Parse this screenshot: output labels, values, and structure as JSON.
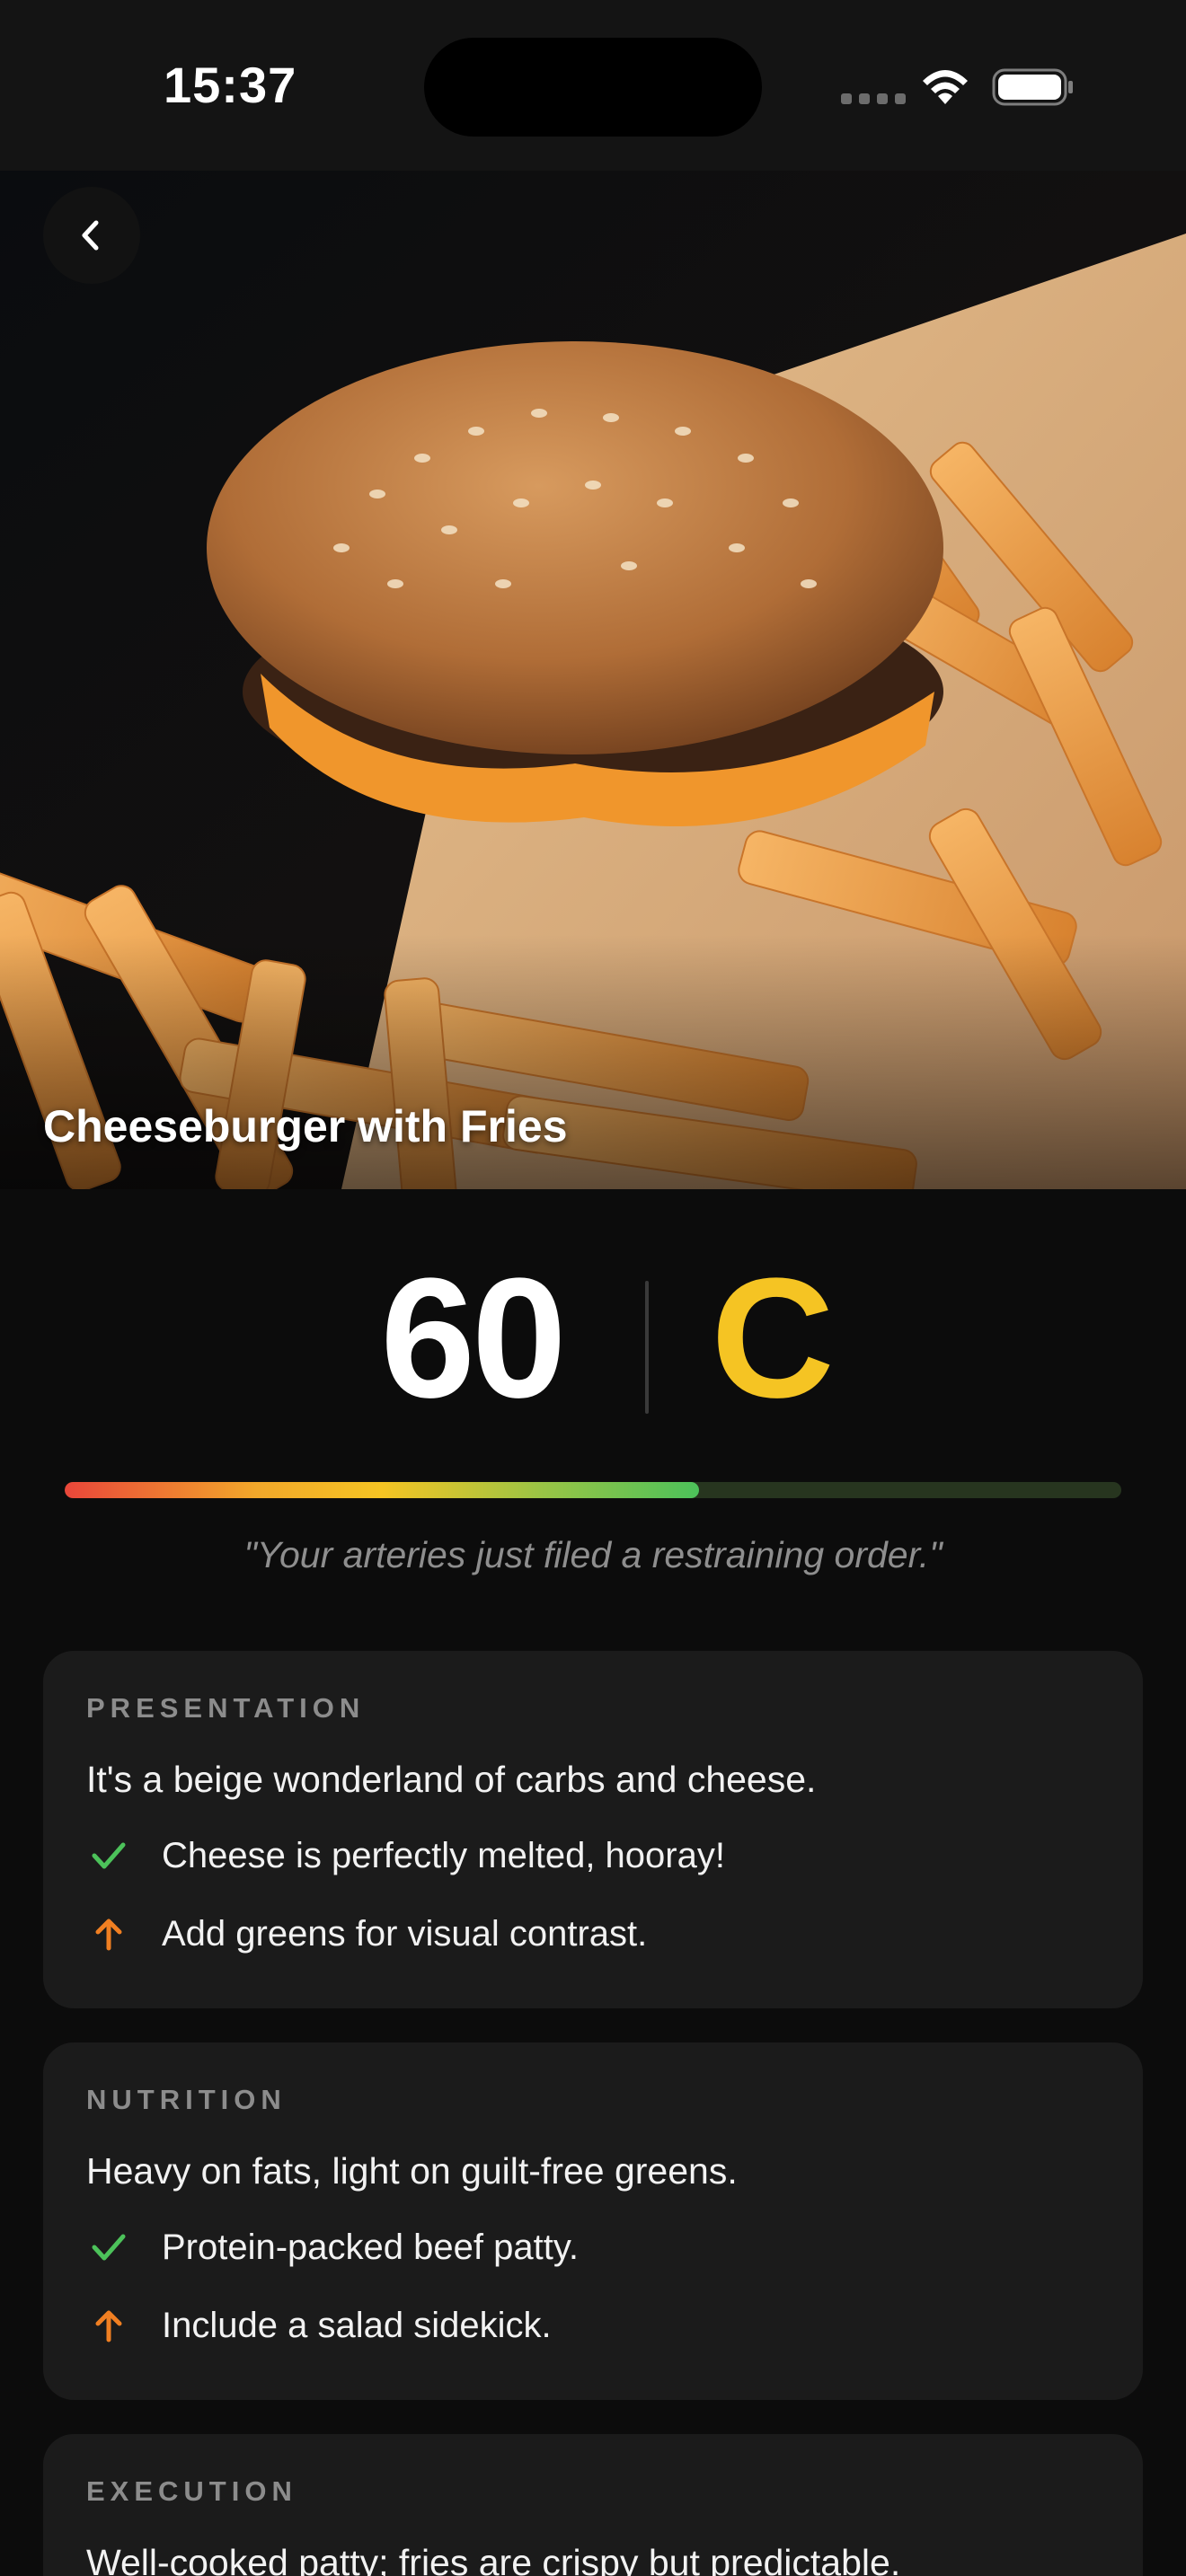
{
  "status_bar": {
    "time": "15:37",
    "icons": [
      "cellular-icon",
      "wifi-icon",
      "battery-icon"
    ]
  },
  "header": {
    "back_icon": "chevron-left-icon",
    "title": "Cheeseburger with Fries"
  },
  "score": {
    "value": "60",
    "grade": "C",
    "grade_color": "#f5c423",
    "bar_fraction": 0.6,
    "quote": "\"Your arteries just filed a restraining order.\""
  },
  "colors": {
    "positive": "#4cc25a",
    "improve": "#f07f22",
    "card_bg": "#1b1b1b"
  },
  "sections": [
    {
      "label": "PRESENTATION",
      "summary": "It's a beige wonderland of carbs and cheese.",
      "positive": {
        "icon": "checkmark-icon",
        "text": "Cheese is perfectly melted, hooray!"
      },
      "improve": {
        "icon": "arrow-up-icon",
        "text": "Add greens for visual contrast."
      }
    },
    {
      "label": "NUTRITION",
      "summary": "Heavy on fats, light on guilt-free greens.",
      "positive": {
        "icon": "checkmark-icon",
        "text": "Protein-packed beef patty."
      },
      "improve": {
        "icon": "arrow-up-icon",
        "text": "Include a salad sidekick."
      }
    },
    {
      "label": "EXECUTION",
      "summary": "Well-cooked patty; fries are crispy but predictable."
    }
  ]
}
